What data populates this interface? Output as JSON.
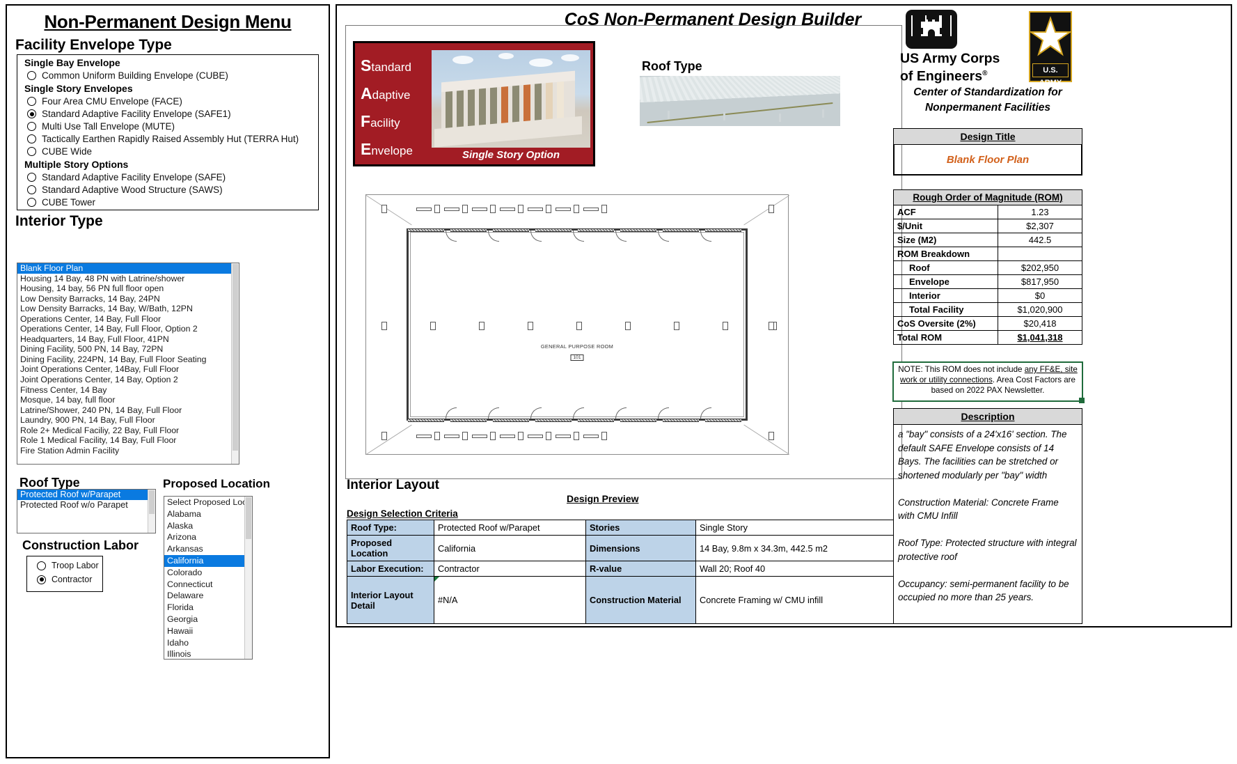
{
  "left": {
    "menu_title": "Non-Permanent Design Menu",
    "facility_envelope_title": "Facility Envelope Type",
    "groups": [
      {
        "heading": "Single Bay Envelope",
        "options": [
          {
            "label": "Common Uniform Building Envelope (CUBE)",
            "selected": false
          }
        ]
      },
      {
        "heading": "Single Story Envelopes",
        "options": [
          {
            "label": "Four Area CMU Envelope (FACE)",
            "selected": false
          },
          {
            "label": "Standard Adaptive  Facility Envelope (SAFE1)",
            "selected": true
          },
          {
            "label": "Multi Use Tall Envelope (MUTE)",
            "selected": false
          },
          {
            "label": "Tactically Earthen Rapidly Raised Assembly Hut (TERRA Hut)",
            "selected": false
          },
          {
            "label": "CUBE Wide",
            "selected": false
          }
        ]
      },
      {
        "heading": "Multiple Story Options",
        "options": [
          {
            "label": "Standard Adaptive Facility Envelope (SAFE)",
            "selected": false
          },
          {
            "label": "Standard Adaptive Wood Structure (SAWS)",
            "selected": false
          },
          {
            "label": "CUBE Tower",
            "selected": false
          }
        ]
      }
    ],
    "interior_type_title": "Interior Type",
    "interior_types": [
      {
        "label": "Blank Floor Plan",
        "selected": true
      },
      {
        "label": "Housing 14 Bay, 48 PN with Latrine/shower",
        "selected": false
      },
      {
        "label": "Housing, 14 bay, 56 PN full floor open",
        "selected": false
      },
      {
        "label": "Low Density Barracks, 14 Bay, 24PN",
        "selected": false
      },
      {
        "label": "Low Density Barracks, 14 Bay, W/Bath, 12PN",
        "selected": false
      },
      {
        "label": "Operations Center, 14 Bay, Full Floor",
        "selected": false
      },
      {
        "label": "Operations Center, 14 Bay, Full Floor, Option 2",
        "selected": false
      },
      {
        "label": "Headquarters, 14 Bay, Full Floor, 41PN",
        "selected": false
      },
      {
        "label": "Dining Facility, 500 PN, 14 Bay, 72PN",
        "selected": false
      },
      {
        "label": "Dining Facility, 224PN, 14 Bay, Full Floor Seating",
        "selected": false
      },
      {
        "label": "Joint Operations Center, 14Bay, Full Floor",
        "selected": false
      },
      {
        "label": "Joint Operations Center, 14 Bay, Option 2",
        "selected": false
      },
      {
        "label": "Fitness Center, 14 Bay",
        "selected": false
      },
      {
        "label": "Mosque, 14 bay,  full floor",
        "selected": false
      },
      {
        "label": "Latrine/Shower, 240 PN, 14 Bay, Full Floor",
        "selected": false
      },
      {
        "label": "Laundry, 900 PN, 14 Bay, Full Floor",
        "selected": false
      },
      {
        "label": "Role 2+ Medical Faciliy, 22 Bay, Full Floor",
        "selected": false
      },
      {
        "label": "Role 1 Medical Facility, 14 Bay, Full Floor",
        "selected": false
      },
      {
        "label": "Fire Station Admin Facility",
        "selected": false
      }
    ],
    "roof_type_title": "Roof Type",
    "roof_types": [
      {
        "label": "Protected Roof w/Parapet",
        "selected": true
      },
      {
        "label": "Protected Roof w/o Parapet",
        "selected": false
      }
    ],
    "proposed_location_title": "Proposed Location",
    "locations": [
      {
        "label": "Select Proposed Locati",
        "selected": false
      },
      {
        "label": "Alabama",
        "selected": false
      },
      {
        "label": "Alaska",
        "selected": false
      },
      {
        "label": "Arizona",
        "selected": false
      },
      {
        "label": "Arkansas",
        "selected": false
      },
      {
        "label": "California",
        "selected": true
      },
      {
        "label": "Colorado",
        "selected": false
      },
      {
        "label": "Connecticut",
        "selected": false
      },
      {
        "label": "Delaware",
        "selected": false
      },
      {
        "label": "Florida",
        "selected": false
      },
      {
        "label": "Georgia",
        "selected": false
      },
      {
        "label": "Hawaii",
        "selected": false
      },
      {
        "label": "Idaho",
        "selected": false
      },
      {
        "label": "Illinois",
        "selected": false
      }
    ],
    "construction_labor_title": "Construction Labor",
    "labor_options": [
      {
        "label": "Troop Labor",
        "selected": false
      },
      {
        "label": "Contractor",
        "selected": true
      }
    ]
  },
  "builder": {
    "title": "CoS Non-Permanent Design Builder",
    "safe_words": [
      {
        "initial": "S",
        "rest": "tandard"
      },
      {
        "initial": "A",
        "rest": "daptive"
      },
      {
        "initial": "F",
        "rest": "acility"
      },
      {
        "initial": "E",
        "rest": "nvelope"
      }
    ],
    "safe_caption": "Single Story Option",
    "roof_type_label": "Roof Type",
    "floorplan_room_label": "GENERAL PURPOSE ROOM",
    "floorplan_room_number": "101",
    "interior_layout_label": "Interior Layout",
    "design_preview_label": "Design Preview",
    "design_selection_criteria_label": "Design Selection Criteria",
    "criteria": [
      {
        "k1": "Roof Type:",
        "v1": "Protected Roof w/Parapet",
        "k2": "Stories",
        "v2": "Single Story"
      },
      {
        "k1": "Proposed Location",
        "v1": "California",
        "k2": "Dimensions",
        "v2": "14 Bay, 9.8m x 34.3m, 442.5 m2"
      },
      {
        "k1": "Labor Execution:",
        "v1": "Contractor",
        "k2": "R-value",
        "v2": "Wall 20; Roof 40"
      },
      {
        "k1": "Interior Layout Detail",
        "v1": "#N/A",
        "k2": "Construction Material",
        "v2": "Concrete Framing w/ CMU infill"
      }
    ]
  },
  "right": {
    "usace_line1": "US Army Corps",
    "usace_line2": "of Engineers",
    "usace_reg": "®",
    "army_tag": "U.S. ARMY",
    "cos_sub_line1": "Center of Standardization for",
    "cos_sub_line2": "Nonpermanent Facilities",
    "design_title_header": "Design Title",
    "design_title_value": "Blank Floor Plan",
    "rom_header": "Rough Order of Magnitude (ROM)",
    "rom_rows": [
      {
        "label": "ACF",
        "value": "1.23",
        "indent": false,
        "bold": false
      },
      {
        "label": "$/Unit",
        "value": "$2,307",
        "indent": false,
        "bold": false
      },
      {
        "label": "Size (M2)",
        "value": "442.5",
        "indent": false,
        "bold": false
      },
      {
        "label": "ROM Breakdown",
        "value": "",
        "indent": false,
        "bold": false
      },
      {
        "label": "Roof",
        "value": "$202,950",
        "indent": true,
        "bold": false
      },
      {
        "label": "Envelope",
        "value": "$817,950",
        "indent": true,
        "bold": false
      },
      {
        "label": "Interior",
        "value": "$0",
        "indent": true,
        "bold": false
      },
      {
        "label": "Total Facility",
        "value": "$1,020,900",
        "indent": true,
        "bold": false
      },
      {
        "label": "CoS Oversite (2%)",
        "value": "$20,418",
        "indent": false,
        "bold": false
      },
      {
        "label": "Total ROM",
        "value": "$1,041,318",
        "indent": false,
        "bold": true
      }
    ],
    "note_prefix": "NOTE: This ROM does not include ",
    "note_underlined": "any FF&E,  site work or utility connections",
    "note_suffix": ". Area Cost Factors are based on 2022 PAX Newsletter.",
    "description_header": "Description",
    "description_body": "a \"bay\" consists of a 24'x16' section. The default SAFE Envelope consists of 14 Bays. The facilities can be stretched or shortened modularly per \"bay\" width\n\nConstruction Material: Concrete Frame with CMU Infill\n\nRoof Type: Protected structure with integral protective roof\n\nOccupancy: semi-permanent facility to be occupied no more than 25 years.",
    "accent_color": "#D2601A",
    "highlight_color": "#0a7ae0",
    "note_border_color": "#1f6b3b"
  }
}
